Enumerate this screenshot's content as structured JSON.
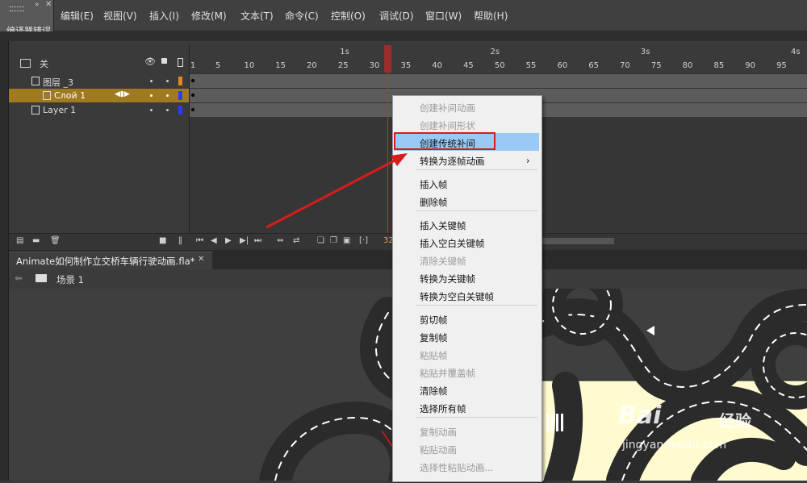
{
  "menubar": {
    "items": [
      "编辑(E)",
      "视图(V)",
      "插入(I)",
      "修改(M)",
      "文本(T)",
      "命令(C)",
      "控制(O)",
      "调试(D)",
      "窗口(W)",
      "帮助(H)"
    ]
  },
  "error_panel": {
    "label": "编译器错误",
    "collapse_glyph": "»",
    "close_glyph": "✕"
  },
  "timeline": {
    "header_label": "关",
    "seconds": [
      "1s",
      "2s",
      "3s",
      "4s"
    ],
    "frame_ticks": [
      "1",
      "5",
      "10",
      "15",
      "20",
      "25",
      "30",
      "35",
      "40",
      "45",
      "50",
      "55",
      "60",
      "65",
      "70",
      "75",
      "80",
      "85",
      "90",
      "95"
    ],
    "layers": [
      {
        "name": "图层 _3",
        "color": "#e08a1e"
      },
      {
        "name": "Слой 1",
        "color": "#2a3cff"
      },
      {
        "name": "Layer 1",
        "color": "#2a3cff"
      }
    ],
    "current_frame": "32",
    "current_frame_number": 32
  },
  "document": {
    "tab_title": "Animate如何制作立交桥车辆行驶动画.fla*",
    "tab_close": "✕",
    "scene_label": "场景 1"
  },
  "context_menu": {
    "groups": [
      [
        {
          "label": "创建补间动画",
          "enabled": false
        },
        {
          "label": "创建补间形状",
          "enabled": false
        },
        {
          "label": "创建传统补间",
          "enabled": true,
          "highlighted": true
        },
        {
          "label": "转换为逐帧动画",
          "enabled": true,
          "submenu": true
        }
      ],
      [
        {
          "label": "插入帧",
          "enabled": true
        },
        {
          "label": "删除帧",
          "enabled": true
        }
      ],
      [
        {
          "label": "插入关键帧",
          "enabled": true
        },
        {
          "label": "插入空白关键帧",
          "enabled": true
        },
        {
          "label": "清除关键帧",
          "enabled": false
        },
        {
          "label": "转换为关键帧",
          "enabled": true
        },
        {
          "label": "转换为空白关键帧",
          "enabled": true
        }
      ],
      [
        {
          "label": "剪切帧",
          "enabled": true
        },
        {
          "label": "复制帧",
          "enabled": true
        },
        {
          "label": "粘贴帧",
          "enabled": false
        },
        {
          "label": "粘贴并覆盖帧",
          "enabled": false
        },
        {
          "label": "清除帧",
          "enabled": true
        },
        {
          "label": "选择所有帧",
          "enabled": true
        }
      ],
      [
        {
          "label": "复制动画",
          "enabled": false
        },
        {
          "label": "粘贴动画",
          "enabled": false
        },
        {
          "label": "选择性粘贴动画...",
          "enabled": false
        }
      ]
    ],
    "submenu_glyph": "›"
  },
  "watermark": {
    "brand": "Bai",
    "brand_suffix": "经验",
    "url": "jingyan.baidu.com"
  },
  "colors": {
    "highlight": "#99c9f5",
    "annotation_red": "#d81c1c",
    "road": "#2b2b2b",
    "grass": "#fffbd0"
  }
}
